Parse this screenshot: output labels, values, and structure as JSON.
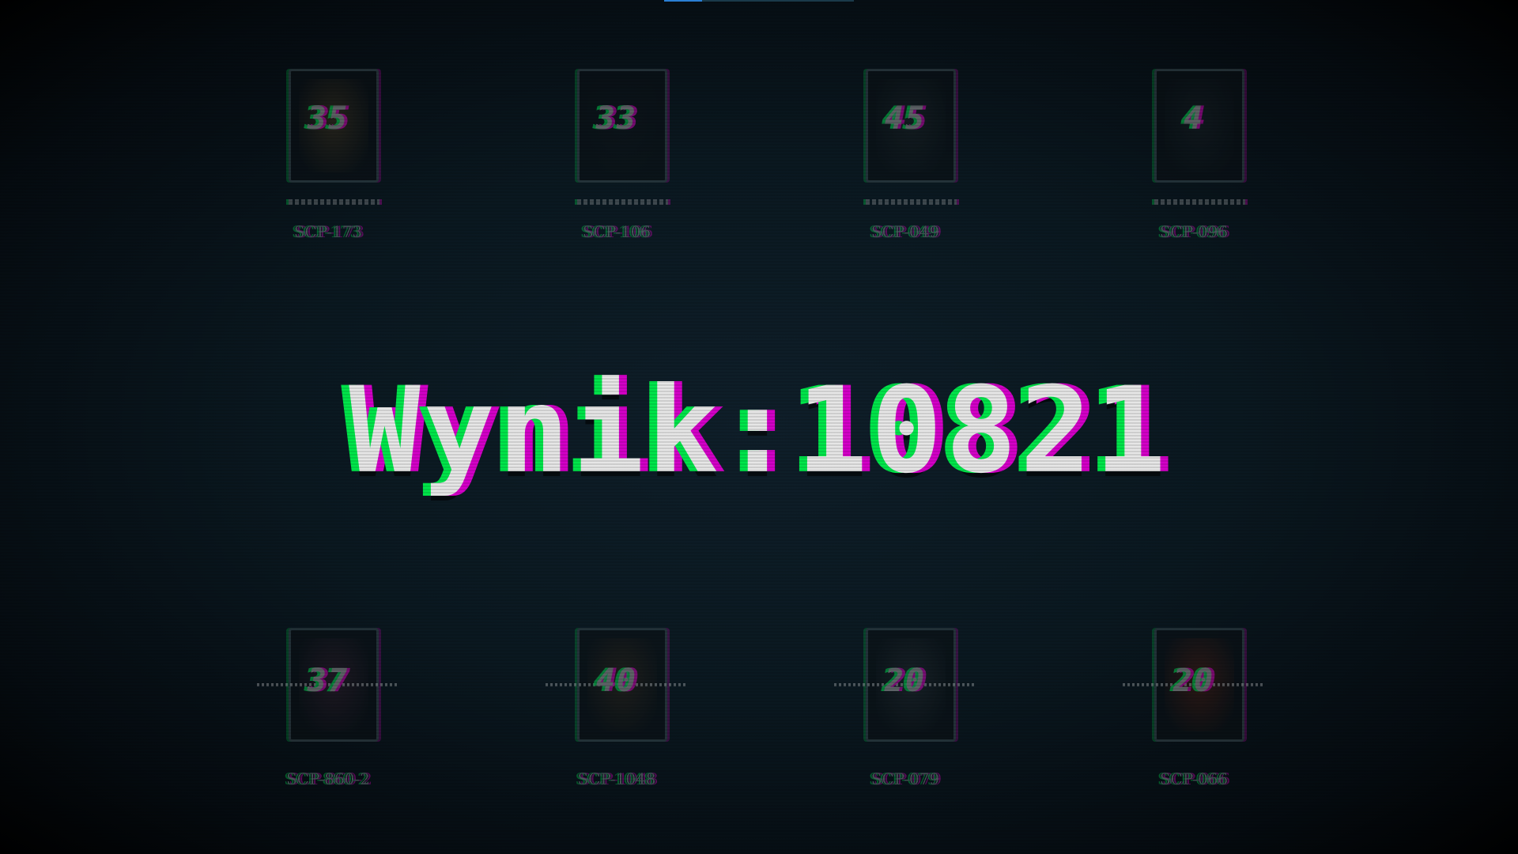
{
  "score": {
    "label": "Wynik",
    "separator": ":",
    "value": "10821"
  },
  "cards_top": [
    {
      "label": "SCP-173",
      "code": "35",
      "color": "#4a3a20"
    },
    {
      "label": "SCP-106",
      "code": "33",
      "color": "#101418"
    },
    {
      "label": "SCP-049",
      "code": "45",
      "color": "#202628"
    },
    {
      "label": "SCP-096",
      "code": "4",
      "color": "#1a2226"
    }
  ],
  "cards_bottom": [
    {
      "label": "SCP-860-2",
      "code": "37",
      "color": "#3a2030"
    },
    {
      "label": "SCP-1048",
      "code": "40",
      "color": "#3a2a1a"
    },
    {
      "label": "SCP-079",
      "code": "20",
      "color": "#2a2f33"
    },
    {
      "label": "SCP-066",
      "code": "20",
      "color": "#5a2010"
    }
  ],
  "colors": {
    "glitch_green": "#00e64a",
    "glitch_magenta": "#d400c8",
    "text": "#e6e6e6",
    "progress_accent": "#2a7fd4"
  },
  "progress": {
    "fraction": 0.2
  }
}
